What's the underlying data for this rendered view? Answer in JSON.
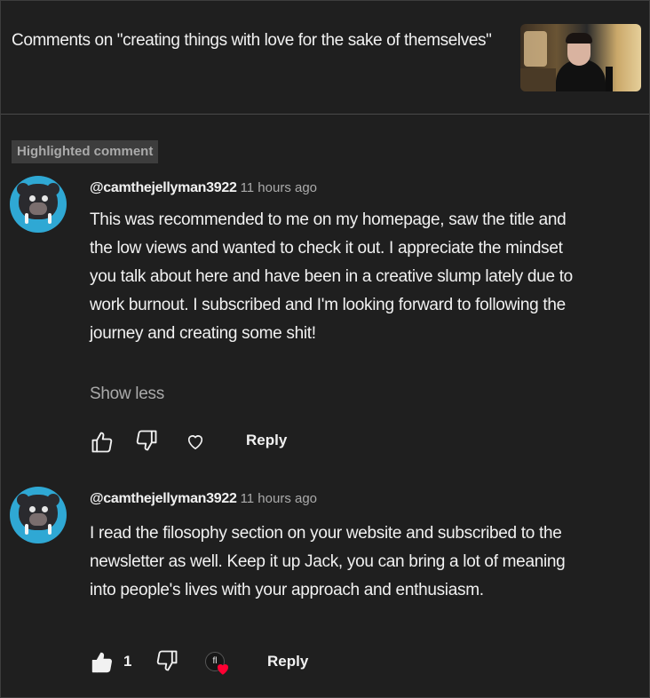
{
  "header": {
    "title": "Comments on \"creating things with love for the sake of themselves\""
  },
  "badge": {
    "label": "Highlighted comment"
  },
  "comments": [
    {
      "handle": "@camthejellyman3922",
      "time": "11 hours ago",
      "text": "This was recommended to me on my homepage, saw the title and the low views and wanted to check it out. I appreciate the mindset you talk about here and have been in a creative slump lately due to work burnout. I subscribed and I'm looking forward to following the journey and creating some shit!",
      "show_less": "Show less",
      "reply_label": "Reply"
    },
    {
      "handle": "@camthejellyman3922",
      "time": "11 hours ago",
      "text": "I read the filosophy section on your website and subscribed to the newsletter as well. Keep it up Jack, you can bring a lot of meaning into people's lives with your approach and enthusiasm.",
      "like_count": "1",
      "reply_label": "Reply",
      "creator_initials": "fl"
    }
  ],
  "icons": {
    "like": "thumb-up-icon",
    "dislike": "thumb-down-icon",
    "heart": "heart-icon",
    "creator_heart": "creator-heart-icon"
  },
  "colors": {
    "background": "#1f1f1f",
    "text": "#f1f1f1",
    "muted": "#aaaaaa",
    "badge_bg": "#3d3d3d",
    "avatar_bg": "#2fa8d4",
    "heart_red": "#ff0033"
  }
}
